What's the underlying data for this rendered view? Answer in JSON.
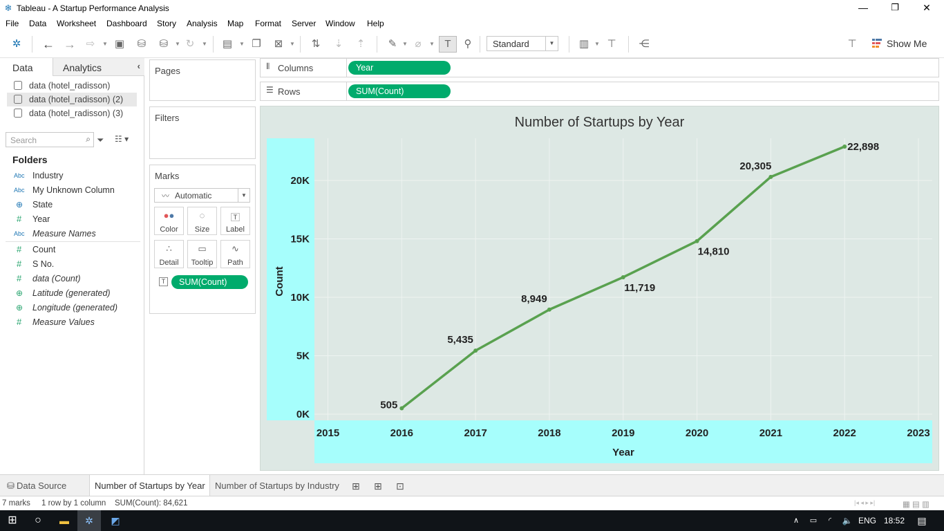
{
  "window": {
    "title": "Tableau - A Startup Performance Analysis",
    "minimize": "—",
    "restore": "❐",
    "close": "✕"
  },
  "menu": [
    "File",
    "Data",
    "Worksheet",
    "Dashboard",
    "Story",
    "Analysis",
    "Map",
    "Format",
    "Server",
    "Window",
    "Help"
  ],
  "toolbar": {
    "fit_select": "Standard",
    "show_me": "Show Me"
  },
  "data_pane": {
    "tabs": {
      "data": "Data",
      "analytics": "Analytics"
    },
    "datasources": [
      "data (hotel_radisson)",
      "data (hotel_radisson) (2)",
      "data (hotel_radisson) (3)"
    ],
    "search_placeholder": "Search",
    "folders_label": "Folders",
    "dimensions": [
      {
        "type": "Abc",
        "label": "Industry"
      },
      {
        "type": "Abc",
        "label": "My Unknown Column"
      },
      {
        "type": "⊕",
        "label": "State"
      },
      {
        "type": "#",
        "label": "Year"
      },
      {
        "type": "Abc",
        "label": "Measure Names"
      }
    ],
    "measures": [
      {
        "type": "#",
        "label": "Count"
      },
      {
        "type": "#",
        "label": "S No."
      },
      {
        "type": "#",
        "label": "data (Count)"
      },
      {
        "type": "⊕",
        "label": "Latitude (generated)"
      },
      {
        "type": "⊕",
        "label": "Longitude (generated)"
      },
      {
        "type": "#",
        "label": "Measure Values"
      }
    ]
  },
  "cards": {
    "pages": "Pages",
    "filters": "Filters",
    "marks": "Marks",
    "mark_type": "Automatic",
    "mark_buttons": [
      "Color",
      "Size",
      "Label",
      "Detail",
      "Tooltip",
      "Path"
    ],
    "marks_pill": "SUM(Count)"
  },
  "shelves": {
    "columns_label": "Columns",
    "columns_pill": "Year",
    "rows_label": "Rows",
    "rows_pill": "SUM(Count)"
  },
  "chart_data": {
    "type": "line",
    "title": "Number of Startups by Year",
    "xlabel": "Year",
    "ylabel": "Count",
    "x": [
      2016,
      2017,
      2018,
      2019,
      2020,
      2021,
      2022
    ],
    "x_ticks": [
      "2015",
      "2016",
      "2017",
      "2018",
      "2019",
      "2020",
      "2021",
      "2022",
      "2023"
    ],
    "y_ticks": [
      "0K",
      "5K",
      "10K",
      "15K",
      "20K"
    ],
    "series": [
      {
        "values": [
          505,
          5435,
          8949,
          11719,
          14810,
          20305,
          22898
        ]
      }
    ],
    "data_labels": [
      "505",
      "5,435",
      "8,949",
      "11,719",
      "14,810",
      "20,305",
      "22,898"
    ],
    "xlim": [
      2015,
      2023
    ],
    "ylim": [
      0,
      22000
    ],
    "line_color": "#59a14f",
    "background_color": "#dde8e4",
    "axis_header_color": "#a6fefc",
    "grid": true
  },
  "sheet_tabs": {
    "data_source": "Data Source",
    "tabs": [
      "Number of Startups by Year",
      "Number of Startups by Industry"
    ]
  },
  "status": {
    "marks": "7 marks",
    "rows_cols": "1 row by 1 column",
    "sum": "SUM(Count): 84,621"
  },
  "taskbar": {
    "lang": "ENG",
    "time": "18:52"
  }
}
